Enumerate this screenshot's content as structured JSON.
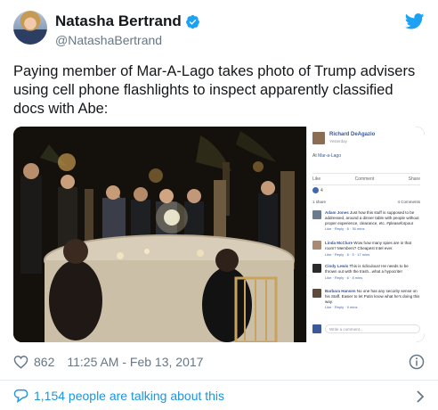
{
  "author": {
    "display_name": "Natasha Bertrand",
    "handle": "@NatashaBertrand",
    "verified": true
  },
  "tweet": {
    "text": "Paying member of Mar-A-Lago takes photo of Trump advisers using cell phone flashlights to inspect apparently classified docs with Abe:"
  },
  "facebook_post": {
    "author": "Richard DeAgazio",
    "time": "Yesterday",
    "location_prefix": "At",
    "location": "Mar-a-Lago",
    "actions": [
      "Like",
      "Comment",
      "Share"
    ],
    "reaction_count": "4",
    "shares": "1 share",
    "comment_count": "4 Comments",
    "comments": [
      {
        "name": "Adam Jones",
        "text": "Just how this stuff is supposed to be addressed, around a dinner table with people without proper experience, clearance, etc. #pleaseforpour",
        "footer": "Like · Reply · 6 · 30 mins",
        "color": "#6b7b8c"
      },
      {
        "name": "Linda McClure",
        "text": "Wow how many spies are in that room? Members? Cheapest Intel ever.",
        "footer": "Like · Reply · 6 · 5 · 17 mins",
        "color": "#a98b74"
      },
      {
        "name": "Cindy Lewis",
        "text": "This is ridiculous! He needs to be thrown out with the trash...what a hypocrite!",
        "footer": "Like · Reply · 6 · 8 mins",
        "color": "#2b2b2b"
      },
      {
        "name": "Barbara Hansen",
        "text": "No one has any security sense on his Staff. Easier to let Putin know what he's doing this way.",
        "footer": "Like · Reply · 9 mins",
        "color": "#5c4a3d"
      }
    ],
    "write_placeholder": "Write a comment..."
  },
  "footer": {
    "likes": "862",
    "timestamp": "11:25 AM - Feb 13, 2017",
    "talking": "1,154 people are talking about this"
  },
  "colors": {
    "twitter_blue": "#1da1f2",
    "link_blue": "#1b95e0",
    "muted": "#657786",
    "facebook_blue": "#365899"
  },
  "icons": [
    "verified-icon",
    "twitter-bird-icon",
    "heart-icon",
    "info-icon",
    "comment-bubble-icon",
    "chevron-right-icon"
  ]
}
